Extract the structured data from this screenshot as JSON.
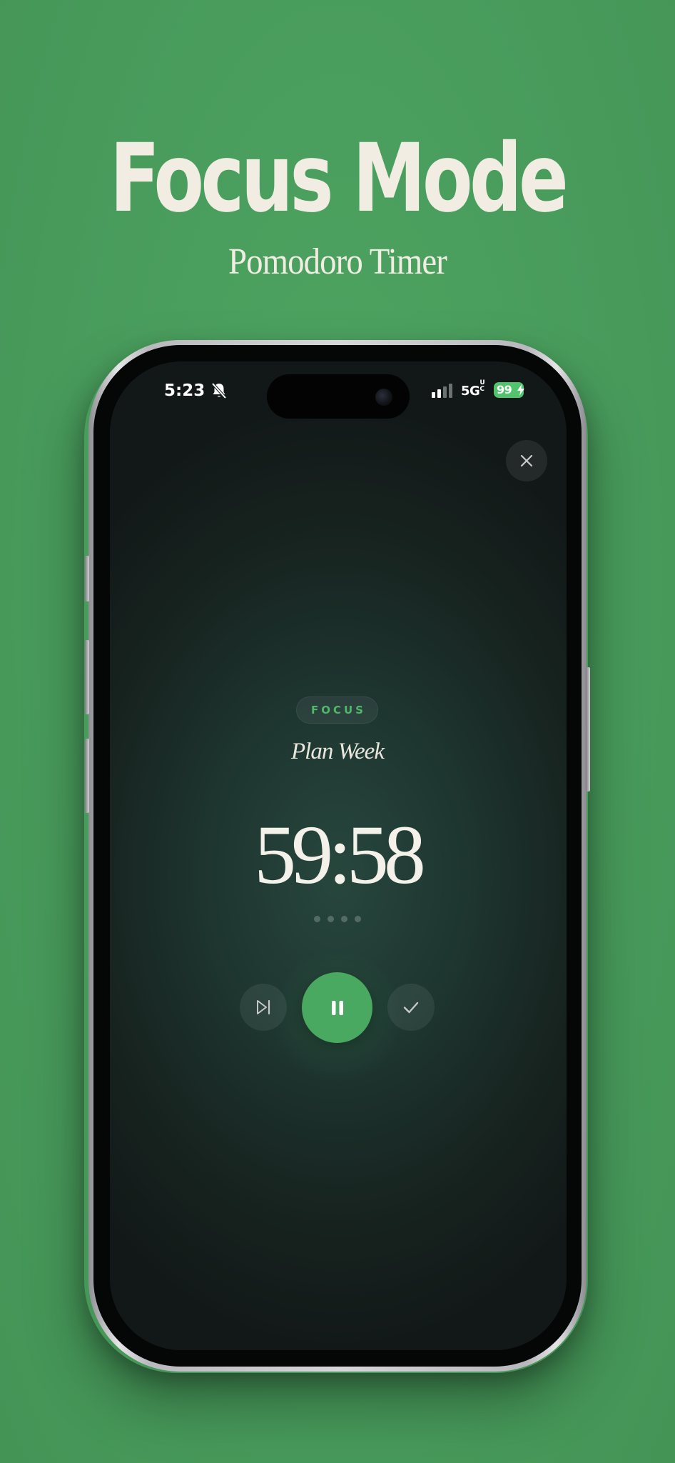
{
  "promo": {
    "title": "Focus Mode",
    "subtitle": "Pomodoro Timer"
  },
  "status_bar": {
    "time": "5:23",
    "network": "5G",
    "network_suffix": "UC",
    "battery": "99",
    "silent_icon": "bell-slash-icon",
    "signal_icon": "cellular-signal-icon",
    "battery_color": "#52c46d"
  },
  "session": {
    "mode_label": "FOCUS",
    "task_name": "Plan Week",
    "time_remaining": "59:58",
    "pomodoro_count": 4
  },
  "controls": {
    "close_icon": "close-icon",
    "skip_icon": "skip-forward-icon",
    "pause_icon": "pause-icon",
    "complete_icon": "checkmark-icon"
  },
  "colors": {
    "background": "#4a9e5e",
    "accent": "#49a960",
    "accent_text": "#4fb86a",
    "title_text": "#f1ede3",
    "screen_dark": "#121818"
  }
}
